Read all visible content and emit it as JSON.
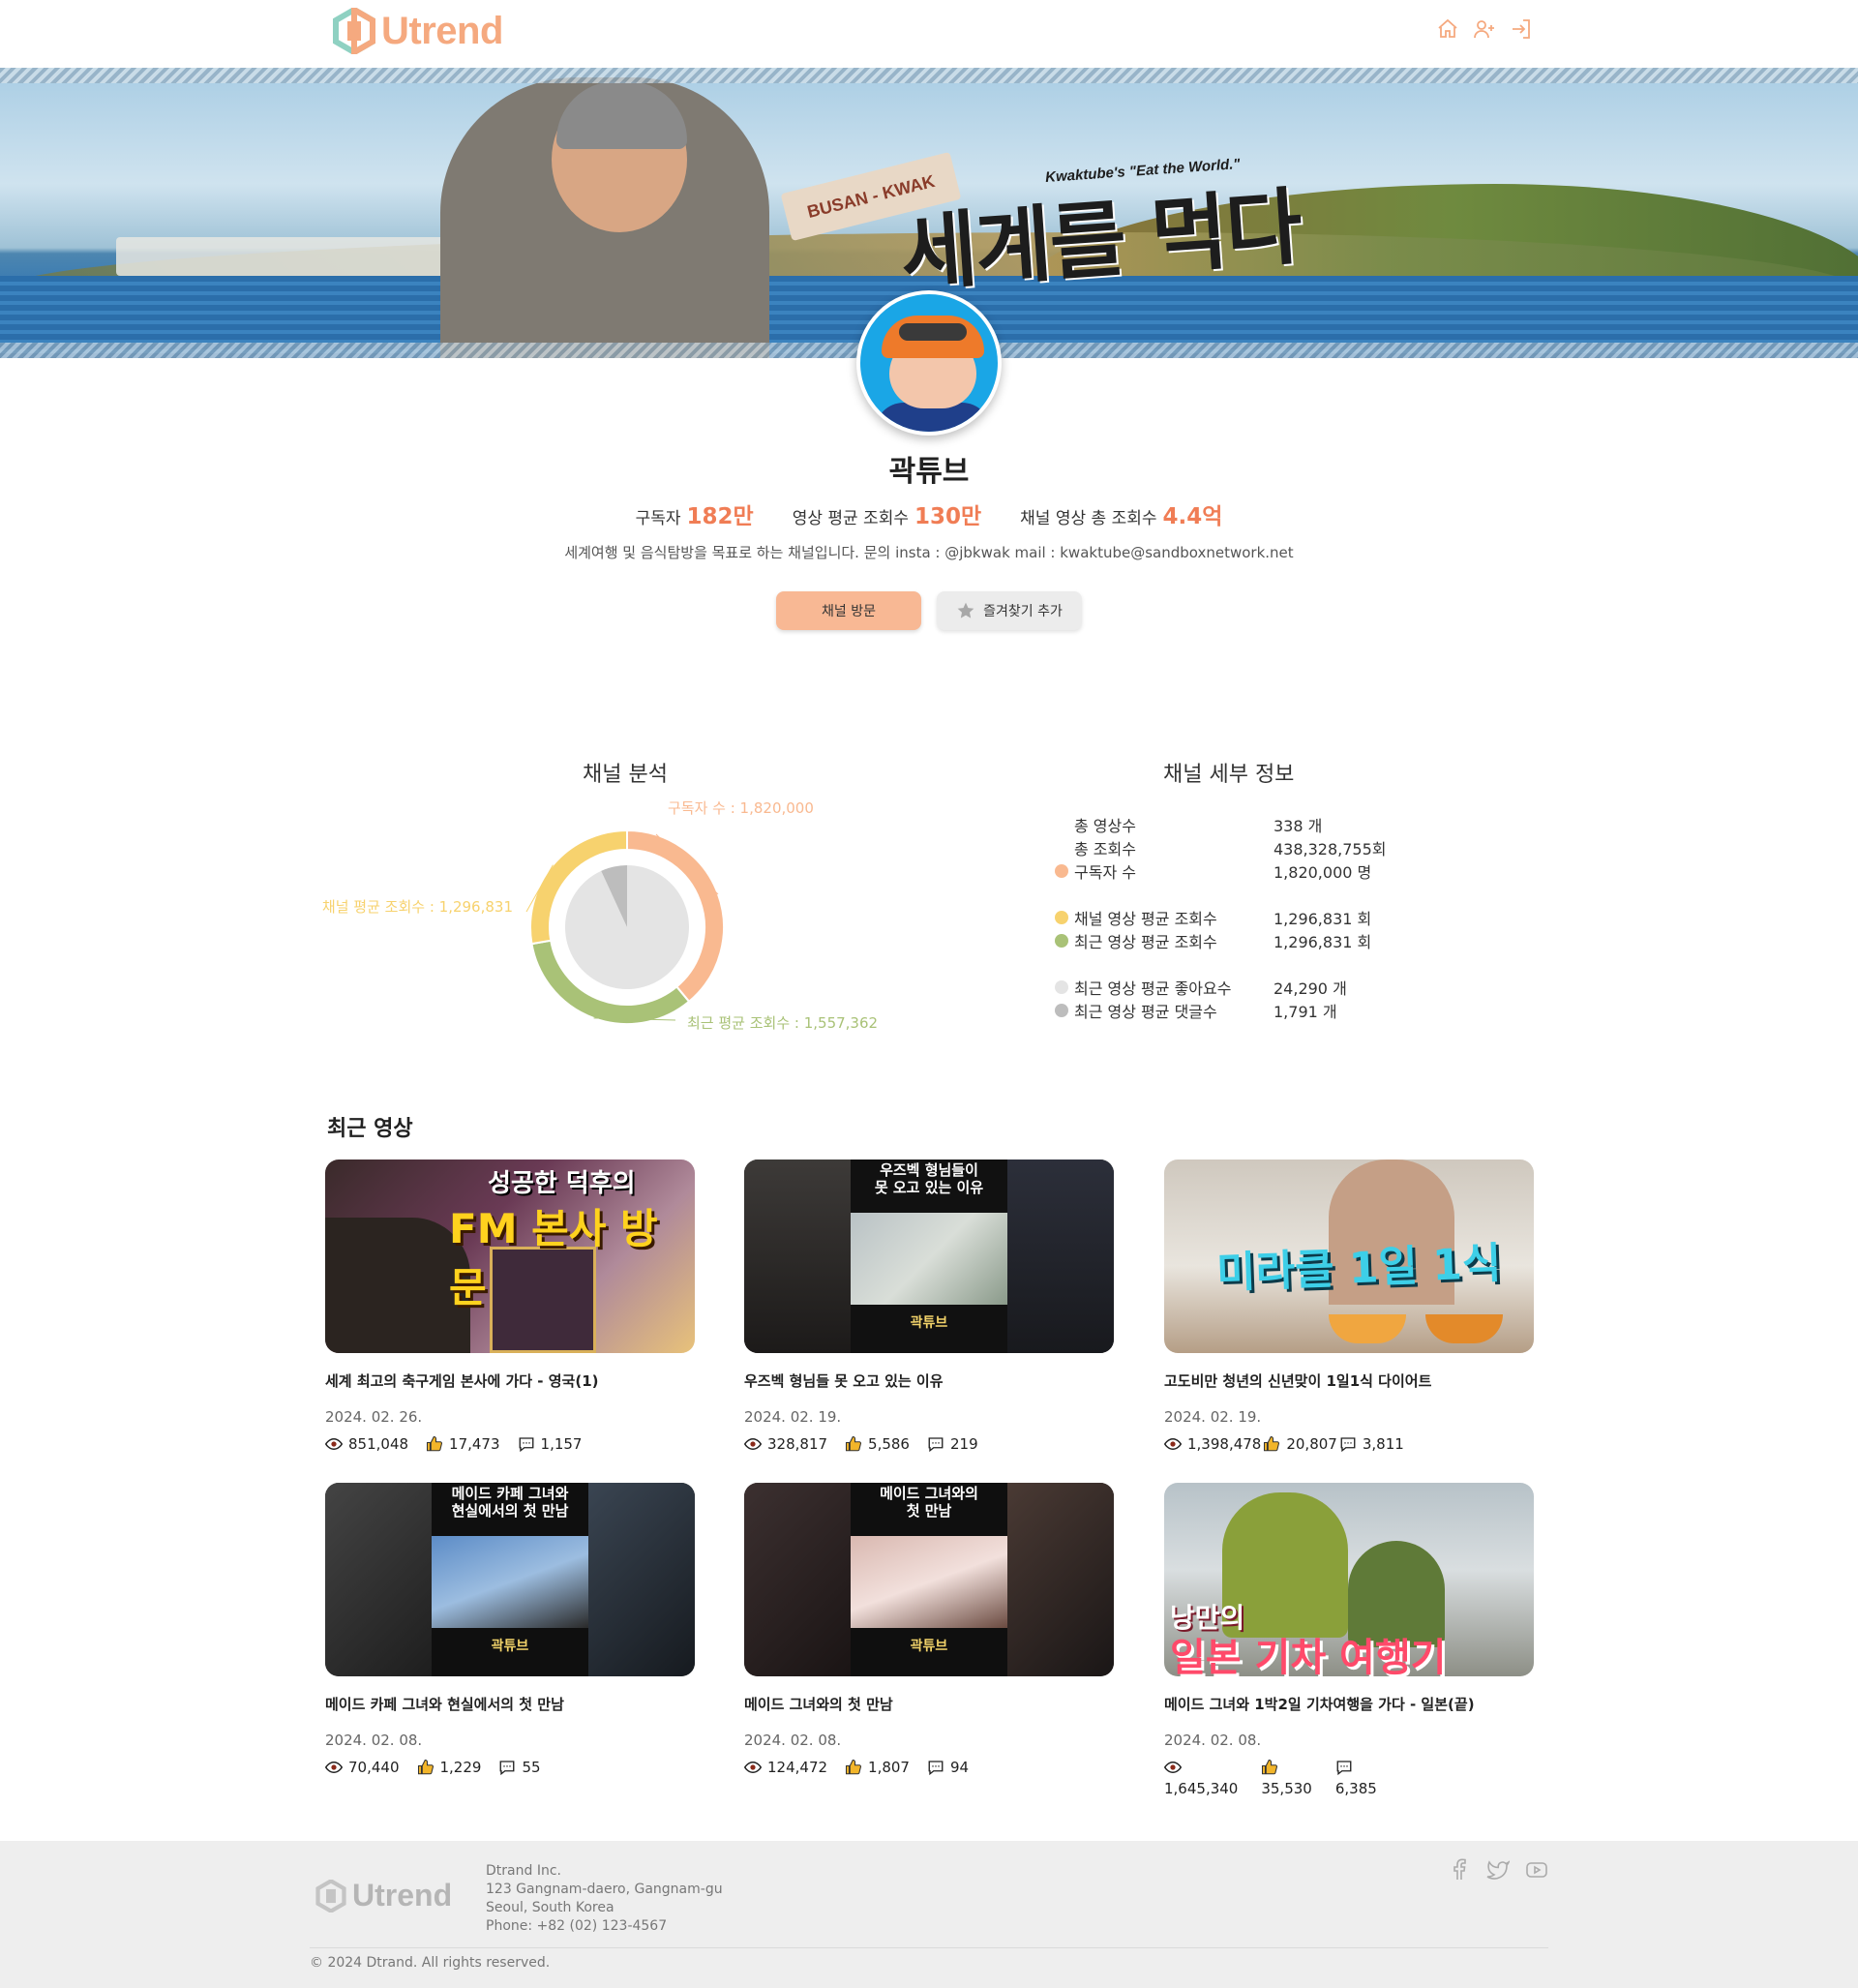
{
  "app": {
    "logo_text": "Utrend"
  },
  "nav": {
    "icons": [
      "home-icon",
      "user-plus-icon",
      "login-icon"
    ]
  },
  "banner": {
    "tag": "BUSAN - KWAK",
    "subtitle": "Kwaktube's \"Eat the World.\"",
    "headline": "세계를 먹다"
  },
  "channel": {
    "name": "곽튜브",
    "stats": [
      {
        "label": "구독자",
        "value": "182만"
      },
      {
        "label": "영상 평균 조회수",
        "value": "130만"
      },
      {
        "label": "채널 영상 총 조회수",
        "value": "4.4억"
      }
    ],
    "description": "세계여행 및 음식탐방을 목표로 하는 채널입니다. 문의 insta : @jbkwak mail : kwaktube@sandboxnetwork.net",
    "visit_label": "채널 방문",
    "favorite_label": "즐겨찾기 추가"
  },
  "analysis": {
    "title": "채널 분석",
    "detail_title": "채널 세부 정보"
  },
  "chart_data": {
    "type": "pie",
    "title": "채널 분석",
    "slices": [
      {
        "label": "구독자 수 : 1,820,000",
        "value": 1820000,
        "color": "#f9b990"
      },
      {
        "label": "최근 평균 조회수 : 1,557,362",
        "value": 1557362,
        "color": "#a9c277"
      },
      {
        "label": "채널 평균 조회수 : 1,296,831",
        "value": 1296831,
        "color": "#f7d26e"
      }
    ],
    "inner": [
      {
        "label": "최근 영상 평균 좋아요수",
        "value": 24290,
        "color": "#e4e4e4"
      },
      {
        "label": "최근 영상 평균 댓글수",
        "value": 1791,
        "color": "#bdbdbd"
      }
    ]
  },
  "details": [
    {
      "label": "총 영상수",
      "value": "338 개",
      "dot": ""
    },
    {
      "label": "총 조회수",
      "value": "438,328,755회",
      "dot": ""
    },
    {
      "label": "구독자 수",
      "value": "1,820,000 명",
      "dot": "#f9b990"
    },
    {
      "label": "채널 영상 평균 조회수",
      "value": "1,296,831 회",
      "dot": "#f7d26e"
    },
    {
      "label": "최근 영상 평균 조회수",
      "value": "1,296,831 회",
      "dot": "#a9c277"
    },
    {
      "label": "최근 영상 평균 좋아요수",
      "value": "24,290 개",
      "dot": "#e4e4e4"
    },
    {
      "label": "최근 영상 평균 댓글수",
      "value": "1,791 개",
      "dot": "#bdbdbd"
    }
  ],
  "recent": {
    "title": "최근 영상"
  },
  "videos": [
    {
      "title": "세계 최고의 축구게임 본사에 가다 - 영국(1)",
      "date": "2024. 02. 26.",
      "views": "851,048",
      "likes": "17,473",
      "comments": "1,157",
      "thumb_text": [
        "성공한 덕후의",
        "FM 본사 방문"
      ]
    },
    {
      "title": "우즈벡 형님들 못 오고 있는 이유",
      "date": "2024. 02. 19.",
      "views": "328,817",
      "likes": "5,586",
      "comments": "219",
      "thumb_text": [
        "우즈벡 형님들이",
        "못 오고 있는 이유",
        "곽튜브"
      ]
    },
    {
      "title": "고도비만 청년의 신년맞이 1일1식 다이어트",
      "date": "2024. 02. 19.",
      "views": "1,398,478",
      "likes": "20,807",
      "comments": "3,811",
      "thumb_text": [
        "미라클 1일 1식"
      ]
    },
    {
      "title": "메이드 카페 그녀와 현실에서의 첫 만남",
      "date": "2024. 02. 08.",
      "views": "70,440",
      "likes": "1,229",
      "comments": "55",
      "thumb_text": [
        "메이드 카페 그녀와",
        "현실에서의 첫 만남",
        "곽튜브"
      ]
    },
    {
      "title": "메이드 그녀와의 첫 만남",
      "date": "2024. 02. 08.",
      "views": "124,472",
      "likes": "1,807",
      "comments": "94",
      "thumb_text": [
        "메이드 그녀와의",
        "첫 만남",
        "곽튜브"
      ]
    },
    {
      "title": "메이드 그녀와 1박2일 기차여행을 가다 - 일본(끝)",
      "date": "2024. 02. 08.",
      "views": "1,645,340",
      "likes": "35,530",
      "comments": "6,385",
      "thumb_text": [
        "낭만의",
        "일본 기차 여행기"
      ]
    }
  ],
  "footer": {
    "logo_text": "Utrend",
    "company": "Dtrand Inc.",
    "address1": "123 Gangnam-daero, Gangnam-gu",
    "address2": "Seoul, South Korea",
    "phone": "Phone: +82 (02) 123-4567",
    "copyright": "© 2024 Dtrand. All rights reserved.",
    "social": [
      "facebook-icon",
      "twitter-icon",
      "youtube-icon"
    ]
  }
}
